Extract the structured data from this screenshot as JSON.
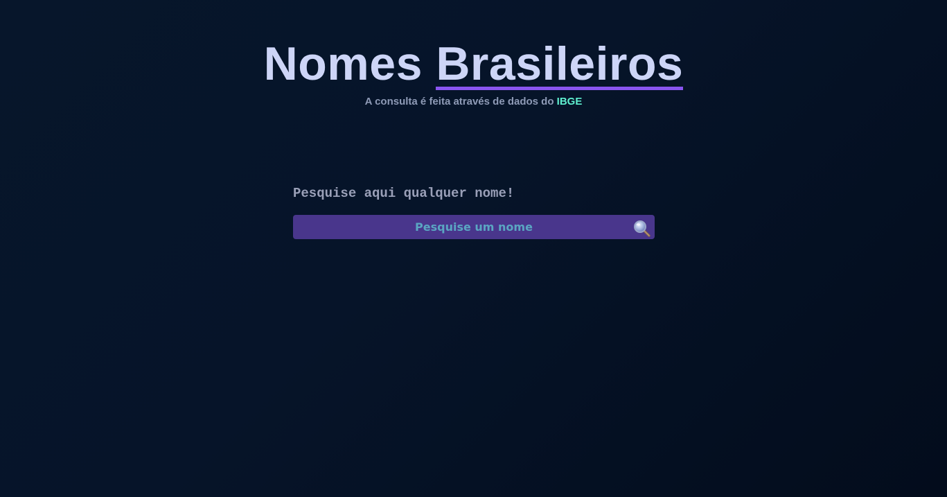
{
  "header": {
    "title_word1": "Nomes",
    "title_word2": "Brasileiros",
    "subtitle_prefix": "A consulta é feita através de dados do",
    "subtitle_highlight": "IBGE"
  },
  "search": {
    "label": "Pesquise aqui qualquer nome!",
    "placeholder": "Pesquise um nome",
    "value": "",
    "icon": "search-icon"
  },
  "colors": {
    "background": "#061429",
    "title": "#cdd5f7",
    "title_underline": "#8a55f0",
    "subtitle": "#8e9ab6",
    "highlight": "#5ff0d0",
    "search_bar": "#49368c",
    "placeholder": "#5aa6c2"
  }
}
